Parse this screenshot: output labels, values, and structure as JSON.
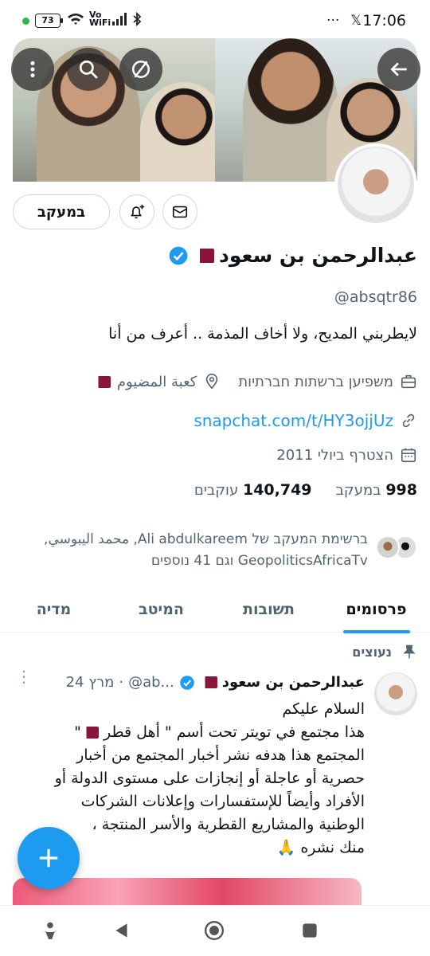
{
  "status_bar": {
    "battery": "73",
    "network": "Vo WiFi",
    "time": "17:06",
    "more": "···",
    "x_logo": "𝕏"
  },
  "header": {
    "back_icon": "back-arrow-icon",
    "more_icon": "vertical-dots-icon",
    "search_icon": "search-icon",
    "circle_icon": "slash-circle-icon"
  },
  "actions": {
    "follow_label": "במעקב",
    "bell_icon": "bell-plus-icon",
    "message_icon": "envelope-icon"
  },
  "profile": {
    "name": "عبدالرحمن بن سعود",
    "handle": "@absqtr86",
    "bio": "لايطربني المديح، ولا أخاف المذمة .. أعرف من أنا",
    "category": "משפיען ברשתות חברתיות",
    "location": "كعبة المضيوم",
    "link": "snapchat.com/t/HY3ojjUz",
    "joined": "הצטרף ביולי 2011",
    "following_count": "998",
    "following_label": "במעקב",
    "followers_count": "140,749",
    "followers_label": "עוקבים",
    "followed_by_prefix": "ברשימת המעקב של",
    "followed_by_names": "Ali abdulkareem, محمد اليبوسي, GeopoliticsAfricaTv",
    "followed_by_suffix": "וגם 41 נוספים"
  },
  "tabs": [
    {
      "label": "פרסומים",
      "active": true
    },
    {
      "label": "תשובות",
      "active": false
    },
    {
      "label": "המיטב",
      "active": false
    },
    {
      "label": "מדיה",
      "active": false
    }
  ],
  "pinned_tweet": {
    "pinned_label": "נעוצים",
    "author": "عبدالرحمن بن سعود",
    "handle_short": "@ab...",
    "date": "24 מרץ",
    "line1": "السلام عليكم",
    "line2": "هذا مجتمع في تويتر تحت أسم \" أهل قطر",
    "line2b": "\"",
    "line3": "المجتمع هذا هدفه نشر أخبار المجتمع من أخبار",
    "line4": "حصرية أو عاجلة أو إنجازات على مستوى الدولة أو",
    "line5": "الأفراد وأيضاً للإستفسارات وإعلانات الشركات",
    "line6": "الوطنية والمشاريع القطرية والأسر المنتجة ،",
    "line7": "منك نشره 🙏"
  },
  "fab": {
    "icon": "plus-icon"
  },
  "colors": {
    "accent": "#1d9bf0",
    "qatar": "#8a1538",
    "text_secondary": "#536471"
  }
}
